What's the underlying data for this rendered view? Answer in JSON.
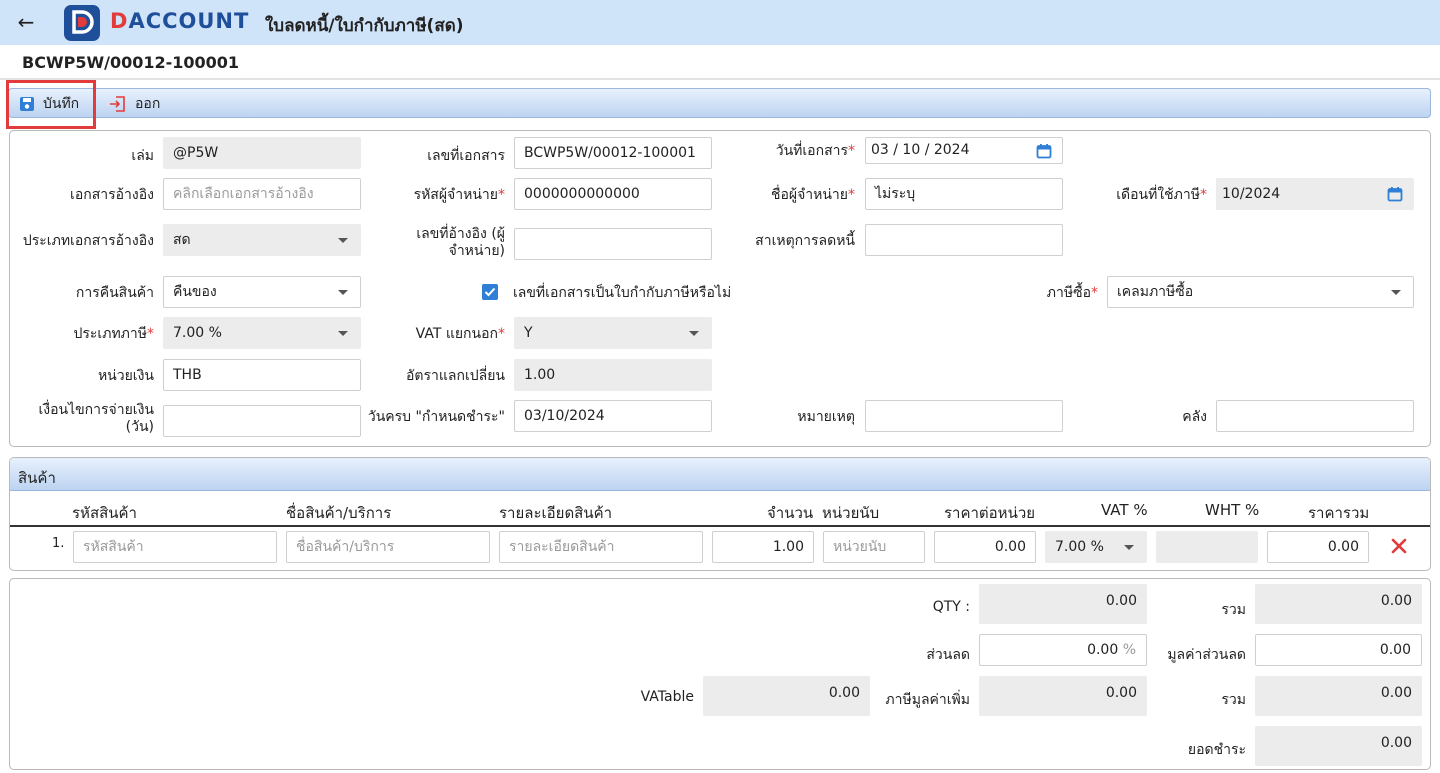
{
  "header": {
    "back_icon": "arrow-left-icon",
    "logo_letter": "D",
    "logo_text_first": "D",
    "logo_text_rest": "ACCOUNT",
    "title": "ใบลดหนี้/ใบกำกับภาษี(สด)"
  },
  "doc_number": "BCWP5W/00012-100001",
  "toolbar": {
    "save_label": "บันทึก",
    "exit_label": "ออก"
  },
  "form": {
    "book": {
      "label": "เล่ม",
      "value": "@P5W"
    },
    "doc_no": {
      "label": "เลขที่เอกสาร",
      "value": "BCWP5W/00012-100001"
    },
    "doc_date": {
      "label": "วันที่เอกสาร",
      "value": "03 / 10 /  2024"
    },
    "ref_doc": {
      "label": "เอกสารอ้างอิง",
      "placeholder": "คลิกเลือกเอกสารอ้างอิง"
    },
    "vendor_code": {
      "label": "รหัสผู้จำหน่าย",
      "value": "0000000000000"
    },
    "vendor_name": {
      "label": "ชื่อผู้จำหน่าย",
      "value": "ไม่ระบุ"
    },
    "tax_month": {
      "label": "เดือนที่ใช้ภาษี",
      "value": "10/2024"
    },
    "ref_type": {
      "label": "ประเภทเอกสารอ้างอิง",
      "value": "สด"
    },
    "vendor_ref_no": {
      "label_line1": "เลขที่อ้างอิง (ผู้",
      "label_line2": "จำหน่าย)",
      "value": ""
    },
    "reduce_reason": {
      "label": "สาเหตุการลดหนี้",
      "value": ""
    },
    "return_goods": {
      "label": "การคืนสินค้า",
      "value": "คืนของ"
    },
    "is_tax_invoice": {
      "label": "เลขที่เอกสารเป็นใบกำกับภาษีหรือไม่",
      "checked": true
    },
    "purchase_tax": {
      "label": "ภาษีซื้อ",
      "value": "เคลมภาษีซื้อ"
    },
    "tax_type": {
      "label": "ประเภทภาษี",
      "value": "7.00 %"
    },
    "vat_separate": {
      "label": "VAT แยกนอก",
      "value": "Y"
    },
    "currency": {
      "label": "หน่วยเงิน",
      "value": "THB"
    },
    "exchange_rate": {
      "label": "อัตราแลกเปลี่ยน",
      "value": "1.00"
    },
    "payment_terms": {
      "label_line1": "เงื่อนไขการจ่ายเงิน",
      "label_line2": "(วัน)",
      "value": ""
    },
    "due_date": {
      "label": "วันครบ \"กำหนดชำระ\"",
      "value": "03/10/2024"
    },
    "remark": {
      "label": "หมายเหตุ",
      "value": ""
    },
    "warehouse": {
      "label": "คลัง",
      "value": ""
    }
  },
  "products": {
    "section_label": "สินค้า",
    "columns": [
      "รหัสสินค้า",
      "ชื่อสินค้า/บริการ",
      "รายละเอียดสินค้า",
      "จำนวน",
      "หน่วยนับ",
      "ราคาต่อหน่วย",
      "VAT %",
      "WHT %",
      "ราคารวม"
    ],
    "rows": [
      {
        "no": "1.",
        "code_placeholder": "รหัสสินค้า",
        "name_placeholder": "ชื่อสินค้า/บริการ",
        "detail_placeholder": "รายละเอียดสินค้า",
        "qty": "1.00",
        "unit_placeholder": "หน่วยนับ",
        "unit_price": "0.00",
        "vat": "7.00 %",
        "wht": "",
        "total": "0.00"
      }
    ],
    "delete_icon": "close-icon",
    "delete_color": "#e23b3b"
  },
  "summary": {
    "qty": {
      "label": "QTY :",
      "value": "0.00"
    },
    "sum1": {
      "label": "รวม",
      "value": "0.00"
    },
    "discount": {
      "label": "ส่วนลด",
      "value": "0.00",
      "unit": "%"
    },
    "discount_value": {
      "label": "มูลค่าส่วนลด",
      "value": "0.00"
    },
    "vatable": {
      "label": "VATable",
      "value": "0.00"
    },
    "vat_amount": {
      "label": "ภาษีมูลค่าเพิ่ม",
      "value": "0.00"
    },
    "sum2": {
      "label": "รวม",
      "value": "0.00"
    },
    "net": {
      "label": "ยอดชำระ",
      "value": "0.00"
    }
  },
  "colors": {
    "header_bg": "#cfe3f9",
    "brand_blue": "#1f4f9a",
    "brand_red": "#e23b3b",
    "highlight": "#e23b3b",
    "checkbox": "#2f7fd6"
  }
}
